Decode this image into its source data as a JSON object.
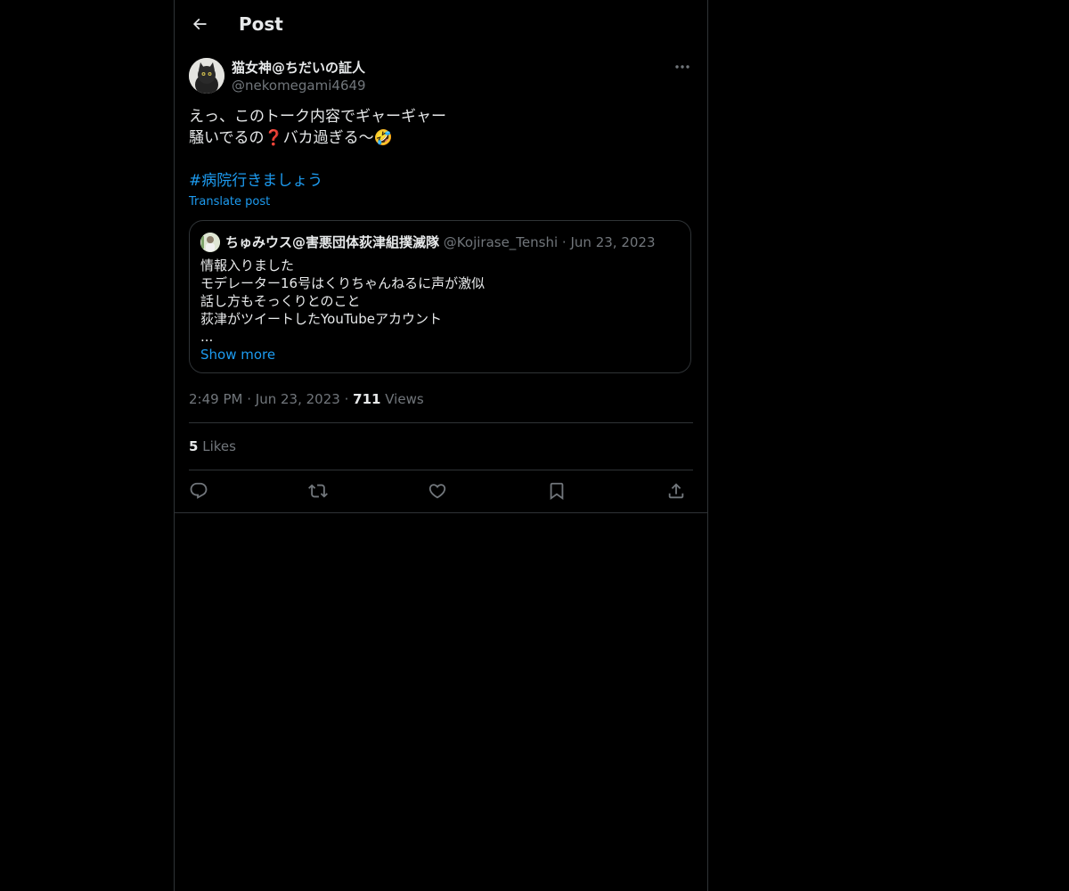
{
  "header": {
    "title": "Post"
  },
  "post": {
    "author_name": "猫女神@ちだいの証人",
    "author_handle": "@nekomegami4649",
    "text": "えっ、このトーク内容でギャーギャー\n騒いでるの❓バカ過ぎる〜🤣",
    "hashtag": "#病院行きましょう",
    "translate_label": "Translate post",
    "time": "2:49 PM",
    "date": "Jun 23, 2023",
    "views_count": "711",
    "views_label": "Views",
    "likes_count": "5",
    "likes_label": "Likes"
  },
  "quote": {
    "author_name": "ちゅみウス@害悪団体荻津組撲滅隊",
    "author_handle": "@Kojirase_Tenshi",
    "separator": "·",
    "date": "Jun 23, 2023",
    "lines": [
      "情報入りました",
      "モデレーター16号はくりちゃんねるに声が激似",
      "話し方もそっくりとのこと",
      "荻津がツイートしたYouTubeアカウント",
      "..."
    ],
    "show_more": "Show more"
  },
  "separator": "·",
  "icons": {
    "back": "arrow-left-icon",
    "more": "ellipsis-icon",
    "reply": "reply-icon",
    "repost": "repost-icon",
    "like": "heart-icon",
    "bookmark": "bookmark-icon",
    "share": "share-icon"
  },
  "colors": {
    "background": "#000000",
    "text": "#e7e9ea",
    "muted": "#71767b",
    "accent": "#1d9bf0",
    "border": "#2f3336"
  }
}
